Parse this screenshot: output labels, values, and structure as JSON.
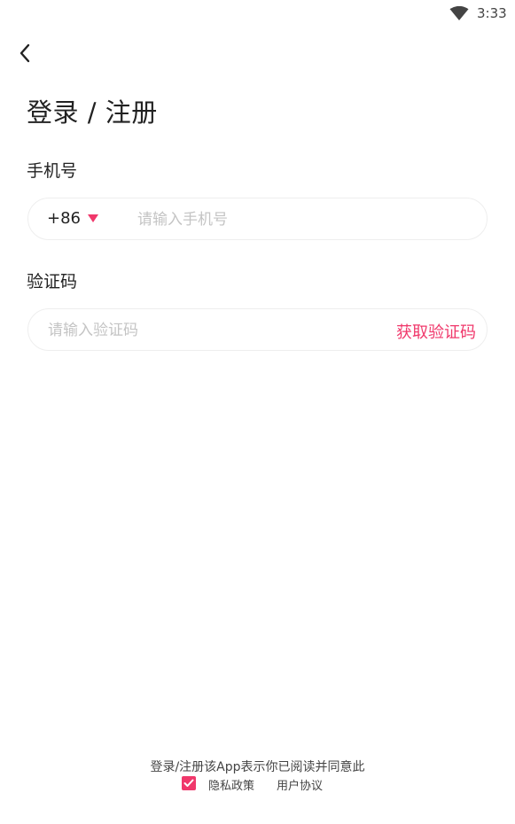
{
  "status_bar": {
    "time": "3:33",
    "wifi_icon": "wifi-icon"
  },
  "header": {
    "back_icon": "chevron-left-icon",
    "title": "登录 / 注册"
  },
  "phone": {
    "label": "手机号",
    "country_code": "+86",
    "dropdown_icon": "caret-down-icon",
    "value": "",
    "placeholder": "请输入手机号"
  },
  "verification": {
    "label": "验证码",
    "value": "",
    "placeholder": "请输入验证码",
    "get_code_label": "获取验证码"
  },
  "agreement": {
    "text": "登录/注册该App表示你已阅读并同意此",
    "checked": true,
    "privacy_label": "隐私政策",
    "terms_label": "用户协议"
  },
  "colors": {
    "accent": "#f0386b",
    "placeholder": "#c4c4c4",
    "text": "#222222"
  }
}
